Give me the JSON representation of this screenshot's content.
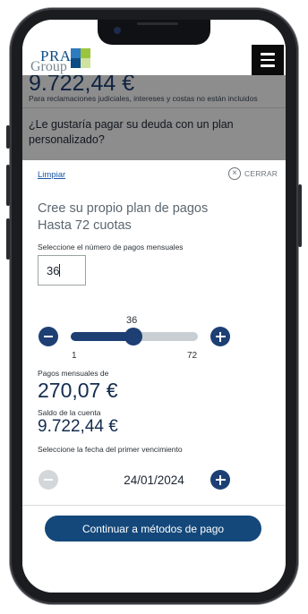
{
  "background_page": {
    "logo": {
      "line1": "PRA",
      "line2": "Group",
      "colors": [
        "#0d4d86",
        "#2f7bbf",
        "#9bc53d",
        "#cfe2a0"
      ]
    },
    "amount": "9.722,44 €",
    "note": "Para reclamaciones judiciales, intereses y costas no están incluidos",
    "question": "¿Le gustaría pagar su deuda con un plan personalizado?",
    "menu_icon": "hamburger-icon"
  },
  "modal": {
    "clear_label": "Limpiar",
    "close_icon": "close-circle-icon",
    "close_label": "CERRAR",
    "title_line1": "Cree su propio plan de pagos",
    "title_line2": "Hasta 72 cuotas",
    "select_payments_label": "Seleccione el número de pagos mensuales",
    "payments_input_value": "36",
    "slider": {
      "value": 36,
      "min": 1,
      "max": 72,
      "value_label": "36",
      "min_label": "1",
      "max_label": "72"
    },
    "monthly_label": "Pagos mensuales de",
    "monthly_value": "270,07 €",
    "balance_label": "Saldo de la cuenta",
    "balance_value": "9.722,44 €",
    "select_date_label": "Seleccione la fecha del primer vencimiento",
    "date_value": "24/01/2024",
    "cta_label": "Continuar a métodos de pago"
  },
  "colors": {
    "accent": "#1d3f74",
    "cta": "#14487a",
    "dim_overlay": "#8d8d8d",
    "link": "#1a56a4"
  }
}
